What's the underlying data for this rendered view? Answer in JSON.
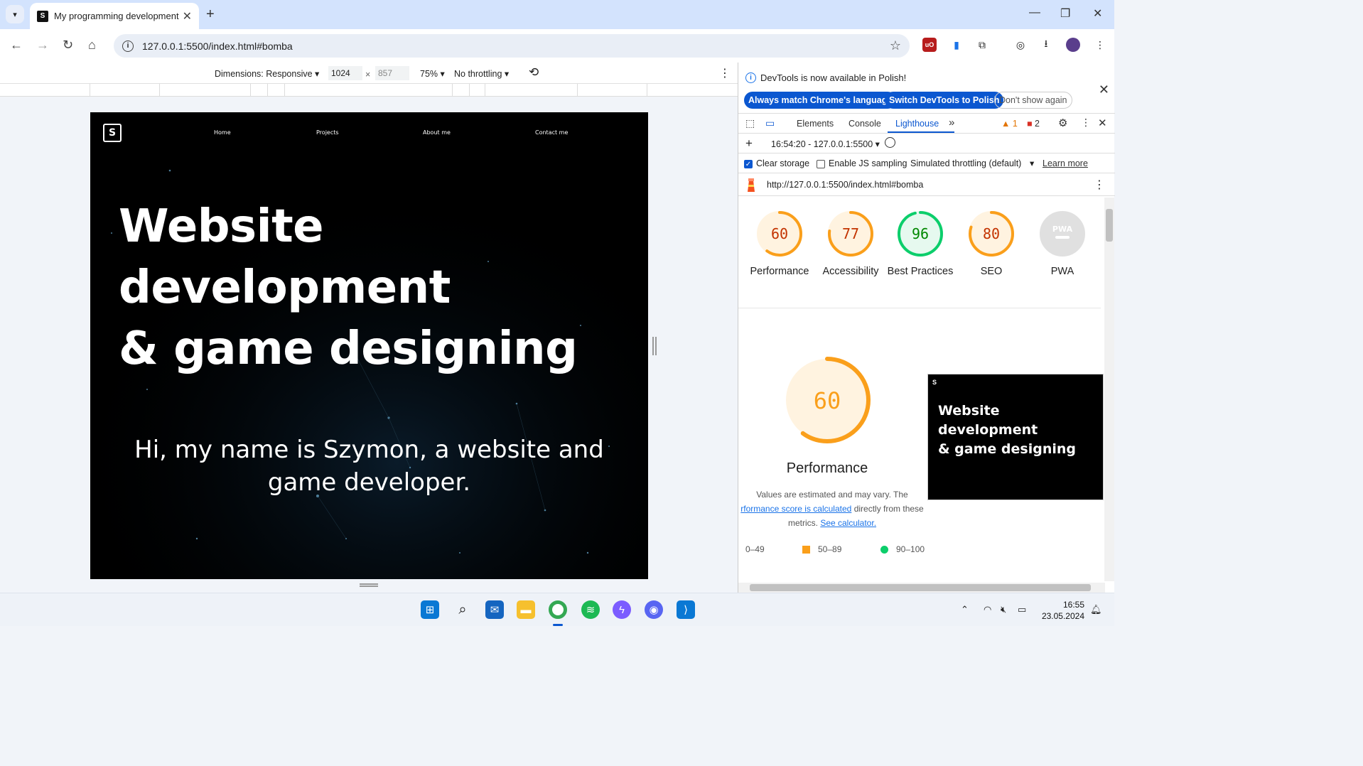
{
  "browser": {
    "tab_title": "My programming development",
    "url": "127.0.0.1:5500/index.html#bomba"
  },
  "device_toolbar": {
    "dimensions_label": "Dimensions: Responsive",
    "width_value": "1024",
    "height_value": "857",
    "zoom": "75%",
    "throttling": "No throttling"
  },
  "page": {
    "nav": [
      "Home",
      "Projects",
      "About me",
      "Contact me"
    ],
    "hero_line1": "Website development",
    "hero_line2": "& game designing",
    "subtitle_line1": "Hi, my name is Szymon, a website and",
    "subtitle_line2": "game developer."
  },
  "devtools": {
    "infobar_message": "DevTools is now available in Polish!",
    "btn_match_language": "Always match Chrome's language",
    "btn_switch_polish": "Switch DevTools to Polish",
    "btn_dont_show": "Don't show again",
    "tabs": [
      "Elements",
      "Console",
      "Lighthouse"
    ],
    "warnings_count": "1",
    "errors_count": "2",
    "report_selector": "16:54:20 - 127.0.0.1:5500",
    "clear_storage": "Clear storage",
    "enable_js_sampling": "Enable JS sampling",
    "throttling_mode": "Simulated throttling (default)",
    "learn_more": "Learn more",
    "report_url": "http://127.0.0.1:5500/index.html#bomba",
    "scores": [
      {
        "label": "Performance",
        "value": "60",
        "color": "#fa9f1b"
      },
      {
        "label": "Accessibility",
        "value": "77",
        "color": "#fa9f1b"
      },
      {
        "label": "Best Practices",
        "value": "96",
        "color": "#0cce6b"
      },
      {
        "label": "SEO",
        "value": "80",
        "color": "#fa9f1b"
      },
      {
        "label": "PWA",
        "value": "PWA",
        "color": "#9e9e9e"
      }
    ],
    "perf_score": "60",
    "perf_title": "Performance",
    "perf_desc_1": "Values are estimated and may vary. The",
    "perf_desc_link": "rformance score is calculated",
    "perf_desc_2": "directly from these",
    "perf_desc_3": "metrics.",
    "perf_desc_link2": "See calculator.",
    "legend": [
      "0–49",
      "50–89",
      "90–100"
    ],
    "thumb_line1": "Website development",
    "thumb_line2": "& game designing"
  },
  "taskbar": {
    "time": "16:55",
    "date": "23.05.2024"
  }
}
